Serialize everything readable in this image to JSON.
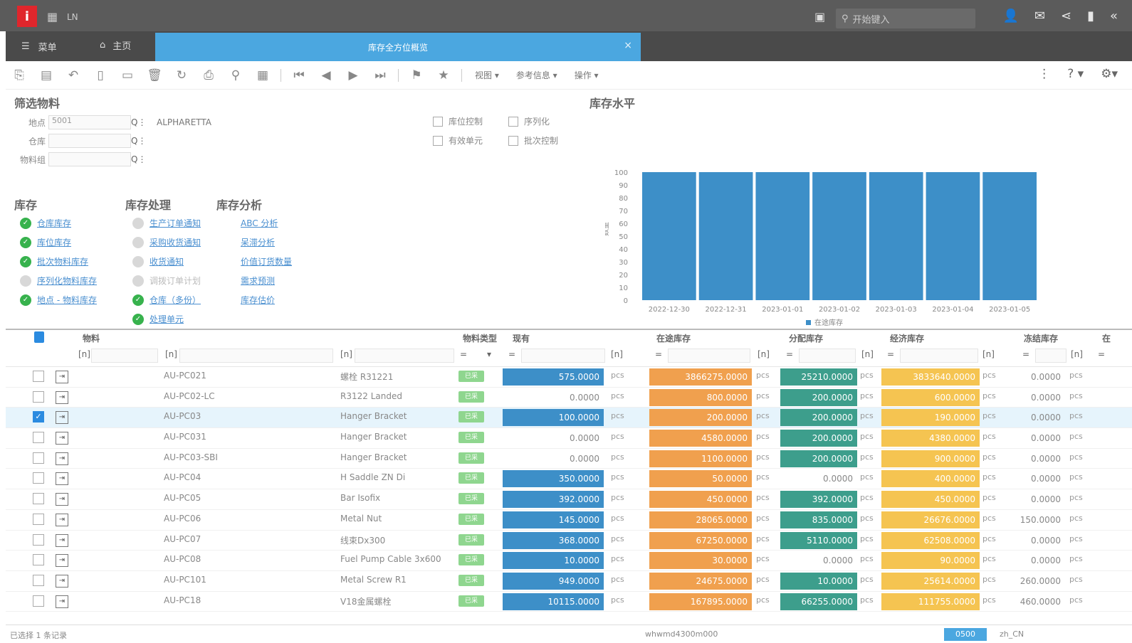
{
  "topbar": {
    "logo": "i",
    "app": "LN",
    "search_placeholder": "开始键入"
  },
  "tabs": {
    "menu": "菜单",
    "home": "主页",
    "active": "库存全方位概览",
    "close": "×"
  },
  "toolbar": {
    "view": "视图 ▾",
    "references": "参考信息 ▾",
    "actions": "操作 ▾",
    "help": "? ▾"
  },
  "filter": {
    "title": "筛选物料",
    "site_label": "地点",
    "site_value": "5001",
    "site_desc": "ALPHARETTA",
    "warehouse_label": "仓库",
    "item_group_label": "物料组",
    "checks": [
      "库位控制",
      "序列化",
      "有效单元",
      "批次控制"
    ]
  },
  "chart_title": "库存水平",
  "sections": {
    "inventory": {
      "title": "库存",
      "links": [
        "仓库库存",
        "库位库存",
        "批次物料库存",
        "序列化物料库存",
        "地点 - 物料库存"
      ]
    },
    "handling": {
      "title": "库存处理",
      "links": [
        "生产订单通知",
        "采购收货通知",
        "收货通知",
        "调拨订单计划",
        "仓库（多份）",
        "处理单元"
      ]
    },
    "analysis": {
      "title": "库存分析",
      "links": [
        "ABC 分析",
        "呆滞分析",
        "价值订货数量",
        "需求预测",
        "库存估价"
      ]
    }
  },
  "chart_data": {
    "type": "bar",
    "categories": [
      "2022-12-30",
      "2022-12-31",
      "2023-01-01",
      "2023-01-02",
      "2023-01-03",
      "2023-01-04",
      "2023-01-05"
    ],
    "series": [
      {
        "name": "在途库存",
        "values": [
          100,
          100,
          100,
          100,
          100,
          100,
          100
        ]
      }
    ],
    "ylabel": "数量",
    "yticks": [
      "0",
      "10",
      "20",
      "30",
      "40",
      "50",
      "60",
      "70",
      "80",
      "90",
      "100"
    ],
    "ylim": [
      0,
      100
    ],
    "color": "#3d8fc8"
  },
  "table": {
    "headers": {
      "item": "物料",
      "type": "物料类型",
      "on_hand": "现有",
      "in_transit": "在途库存",
      "allocated": "分配库存",
      "economic": "经济库存",
      "blocked": "冻结库存",
      "extra": "在"
    },
    "rows": [
      {
        "item": "AU-PC021",
        "desc": "螺栓 R31221",
        "tag": "已采",
        "on_hand": "575.0000",
        "in_transit": "3866275.0000",
        "allocated": "25210.0000",
        "economic": "3833640.0000",
        "blocked": "0.0000"
      },
      {
        "item": "AU-PC02-LC",
        "desc": "R3122 Landed",
        "tag": "已采",
        "on_hand": "0.0000",
        "in_transit": "800.0000",
        "allocated": "200.0000",
        "economic": "600.0000",
        "blocked": "0.0000"
      },
      {
        "item": "AU-PC03",
        "desc": "Hanger Bracket",
        "tag": "已采",
        "on_hand": "100.0000",
        "in_transit": "200.0000",
        "allocated": "200.0000",
        "economic": "190.0000",
        "blocked": "0.0000"
      },
      {
        "item": "AU-PC031",
        "desc": "Hanger Bracket",
        "tag": "已采",
        "on_hand": "0.0000",
        "in_transit": "4580.0000",
        "allocated": "200.0000",
        "economic": "4380.0000",
        "blocked": "0.0000"
      },
      {
        "item": "AU-PC03-SBI",
        "desc": "Hanger Bracket",
        "tag": "已采",
        "on_hand": "0.0000",
        "in_transit": "1100.0000",
        "allocated": "200.0000",
        "economic": "900.0000",
        "blocked": "0.0000"
      },
      {
        "item": "AU-PC04",
        "desc": "H Saddle ZN Di",
        "tag": "已采",
        "on_hand": "350.0000",
        "in_transit": "50.0000",
        "allocated": "0.0000",
        "economic": "400.0000",
        "blocked": "0.0000"
      },
      {
        "item": "AU-PC05",
        "desc": "Bar Isofix",
        "tag": "已采",
        "on_hand": "392.0000",
        "in_transit": "450.0000",
        "allocated": "392.0000",
        "economic": "450.0000",
        "blocked": "0.0000"
      },
      {
        "item": "AU-PC06",
        "desc": "Metal Nut",
        "tag": "已采",
        "on_hand": "145.0000",
        "in_transit": "28065.0000",
        "allocated": "835.0000",
        "economic": "26676.0000",
        "blocked": "150.0000"
      },
      {
        "item": "AU-PC07",
        "desc": "线束Dx300",
        "tag": "已采",
        "on_hand": "368.0000",
        "in_transit": "67250.0000",
        "allocated": "5110.0000",
        "economic": "62508.0000",
        "blocked": "0.0000"
      },
      {
        "item": "AU-PC08",
        "desc": "Fuel Pump Cable 3x600",
        "tag": "已采",
        "on_hand": "10.0000",
        "in_transit": "30.0000",
        "allocated": "0.0000",
        "economic": "90.0000",
        "blocked": "0.0000"
      },
      {
        "item": "AU-PC101",
        "desc": "Metal Screw R1",
        "tag": "已采",
        "on_hand": "949.0000",
        "in_transit": "24675.0000",
        "allocated": "10.0000",
        "economic": "25614.0000",
        "blocked": "260.0000"
      },
      {
        "item": "AU-PC18",
        "desc": "V18金属螺栓",
        "tag": "已采",
        "on_hand": "10115.0000",
        "in_transit": "167895.0000",
        "allocated": "66255.0000",
        "economic": "111755.0000",
        "blocked": "460.0000"
      }
    ],
    "unit": "pcs",
    "filter_hint": "[n]",
    "op": "="
  },
  "status": {
    "selected": "已选择 1 条记录",
    "session": "whwmd4300m000",
    "company": "0500",
    "locale": "zh_CN"
  }
}
